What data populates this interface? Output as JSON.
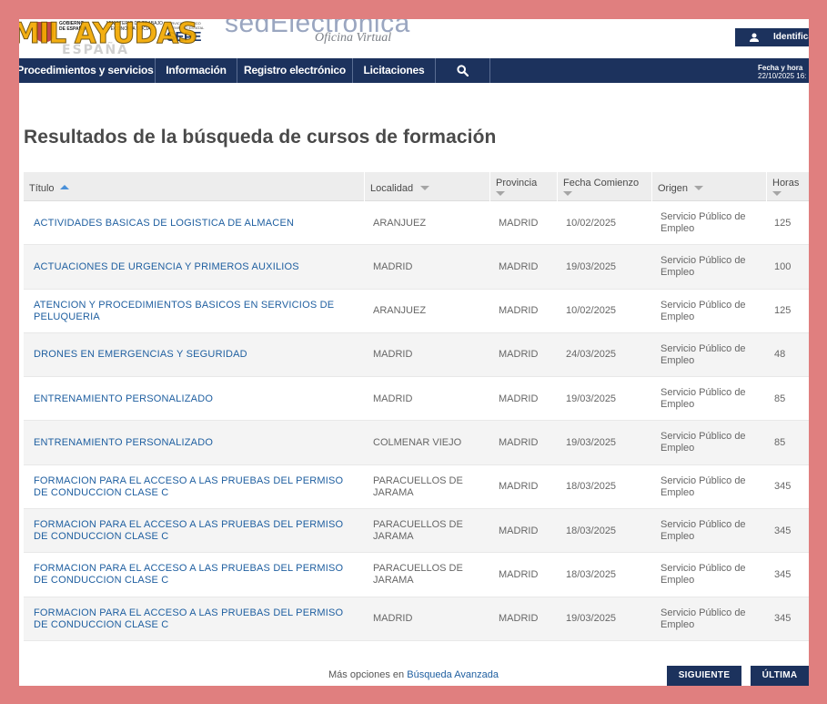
{
  "header": {
    "watermark_main": "MIL AYUDAS",
    "watermark_sub": "ESPAÑA",
    "gov_label": "GOBIERNO DE ESPAÑA",
    "ministry_label": "MINISTERIO DE TRABAJO Y ECONOMÍA SOCIAL",
    "sepe_small": "SERVICIO PÚBLICO DE EMPLEO ESTATAL",
    "sepe_label": "SEPE",
    "sede_label": "sedElectrónica",
    "oficina_label": "Oficina Virtual",
    "identify_label": "Identificarse"
  },
  "nav": {
    "items": [
      {
        "label": "Procedimientos y servicios"
      },
      {
        "label": "Información"
      },
      {
        "label": "Registro electrónico"
      },
      {
        "label": "Licitaciones"
      }
    ],
    "search_icon": "search-icon",
    "datetime_label": "Fecha y hora",
    "datetime_value": "22/10/2025 16:"
  },
  "page": {
    "title": "Resultados de la búsqueda de cursos de formación"
  },
  "table": {
    "columns": [
      "Título",
      "Localidad",
      "Provincia",
      "Fecha Comienzo",
      "Origen",
      "Horas"
    ],
    "sorted_column": "Título",
    "sort_direction": "asc",
    "rows": [
      {
        "titulo": "ACTIVIDADES BASICAS DE LOGISTICA DE ALMACEN",
        "localidad": "ARANJUEZ",
        "provincia": "MADRID",
        "fecha": "10/02/2025",
        "origen": "Servicio Público de Empleo",
        "horas": "125"
      },
      {
        "titulo": "ACTUACIONES DE URGENCIA Y PRIMEROS AUXILIOS",
        "localidad": "MADRID",
        "provincia": "MADRID",
        "fecha": "19/03/2025",
        "origen": "Servicio Público de Empleo",
        "horas": "100"
      },
      {
        "titulo": "ATENCION Y PROCEDIMIENTOS BASICOS EN SERVICIOS DE PELUQUERIA",
        "localidad": "ARANJUEZ",
        "provincia": "MADRID",
        "fecha": "10/02/2025",
        "origen": "Servicio Público de Empleo",
        "horas": "125"
      },
      {
        "titulo": "DRONES EN EMERGENCIAS Y SEGURIDAD",
        "localidad": "MADRID",
        "provincia": "MADRID",
        "fecha": "24/03/2025",
        "origen": "Servicio Público de Empleo",
        "horas": "48"
      },
      {
        "titulo": "ENTRENAMIENTO PERSONALIZADO",
        "localidad": "MADRID",
        "provincia": "MADRID",
        "fecha": "19/03/2025",
        "origen": "Servicio Público de Empleo",
        "horas": "85"
      },
      {
        "titulo": "ENTRENAMIENTO PERSONALIZADO",
        "localidad": "COLMENAR VIEJO",
        "provincia": "MADRID",
        "fecha": "19/03/2025",
        "origen": "Servicio Público de Empleo",
        "horas": "85"
      },
      {
        "titulo": "FORMACION PARA EL ACCESO A LAS PRUEBAS DEL PERMISO DE CONDUCCION CLASE C",
        "localidad": "PARACUELLOS DE JARAMA",
        "provincia": "MADRID",
        "fecha": "18/03/2025",
        "origen": "Servicio Público de Empleo",
        "horas": "345"
      },
      {
        "titulo": "FORMACION PARA EL ACCESO A LAS PRUEBAS DEL PERMISO DE CONDUCCION CLASE C",
        "localidad": "PARACUELLOS DE JARAMA",
        "provincia": "MADRID",
        "fecha": "18/03/2025",
        "origen": "Servicio Público de Empleo",
        "horas": "345"
      },
      {
        "titulo": "FORMACION PARA EL ACCESO A LAS PRUEBAS DEL PERMISO DE CONDUCCION CLASE C",
        "localidad": "PARACUELLOS DE JARAMA",
        "provincia": "MADRID",
        "fecha": "18/03/2025",
        "origen": "Servicio Público de Empleo",
        "horas": "345"
      },
      {
        "titulo": "FORMACION PARA EL ACCESO A LAS PRUEBAS DEL PERMISO DE CONDUCCION CLASE C",
        "localidad": "MADRID",
        "provincia": "MADRID",
        "fecha": "19/03/2025",
        "origen": "Servicio Público de Empleo",
        "horas": "345"
      }
    ]
  },
  "footer": {
    "more_prefix": "Más opciones en",
    "more_link": "Búsqueda Avanzada",
    "next_label": "SIGUIENTE",
    "last_label": "ÚLTIMA"
  },
  "colors": {
    "frame_border": "#e07f7f",
    "nav_bg": "#1c325d",
    "link": "#1f5fa0",
    "sort_active": "#4a90d9"
  }
}
